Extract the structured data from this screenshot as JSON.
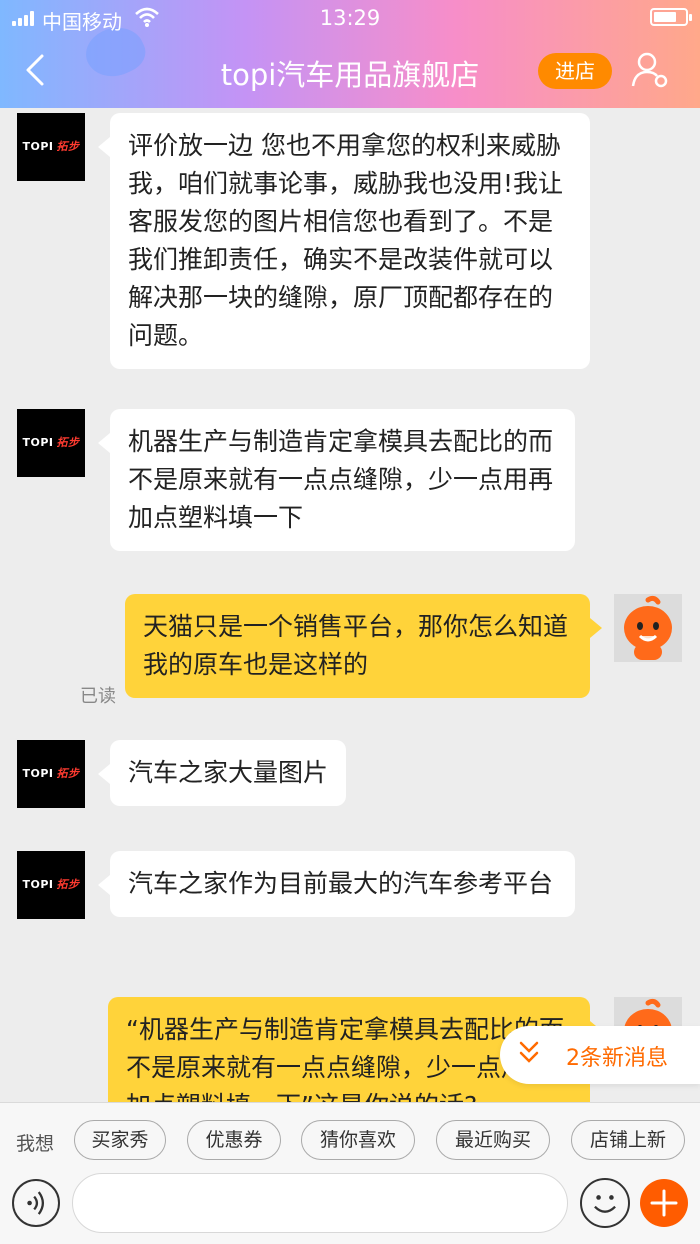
{
  "status_bar": {
    "carrier": "中国移动",
    "time": "13:29"
  },
  "header": {
    "title": "topi汽车用品旗舰店",
    "enter_label": "进店"
  },
  "shop_avatar": {
    "brand": "TOPI",
    "brand_cn": "拓步"
  },
  "messages": [
    {
      "side": "left",
      "text": "评价放一边 您也不用拿您的权利来威胁我，咱们就事论事，威胁我也没用!我让客服发您的图片相信您也看到了。不是我们推卸责任，确实不是改装件就可以解决那一块的缝隙，原厂顶配都存在的问题。"
    },
    {
      "side": "left",
      "text": "机器生产与制造肯定拿模具去配比的而不是原来就有一点点缝隙，少一点用再加点塑料填一下"
    },
    {
      "side": "right",
      "text": "天猫只是一个销售平台，那你怎么知道我的原车也是这样的",
      "status": "已读"
    },
    {
      "side": "left",
      "text": "汽车之家大量图片"
    },
    {
      "side": "left",
      "text": "汽车之家作为目前最大的汽车参考平台"
    },
    {
      "side": "right",
      "text": "“机器生产与制造肯定拿模具去配比的而不是原来就有一点点缝隙，少一点用再加点塑料填一下”这是你说的话?"
    }
  ],
  "new_messages": "2条新消息",
  "quick_bar": {
    "label": "我想",
    "chips": [
      "买家秀",
      "优惠券",
      "猜你喜欢",
      "最近购买",
      "店铺上新"
    ]
  },
  "colors": {
    "accent": "#ff8a00",
    "my_bubble": "#ffd33a",
    "new_msg_text": "#ff6a00"
  }
}
